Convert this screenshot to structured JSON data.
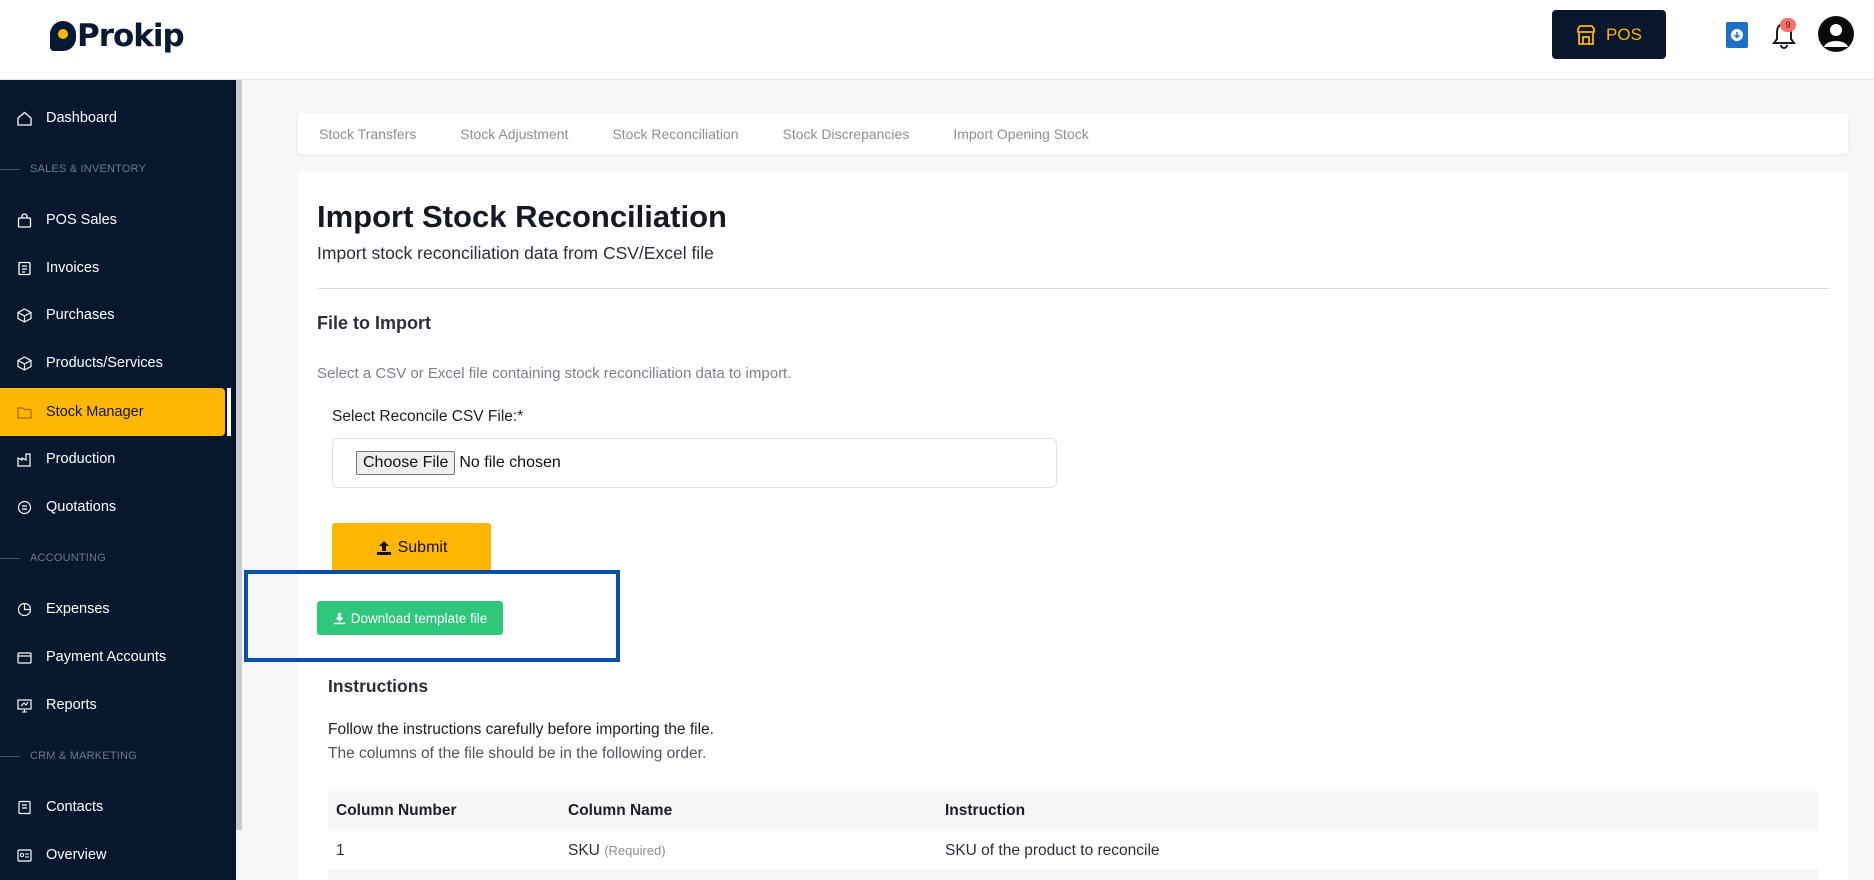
{
  "header": {
    "logo_text": "Prokip",
    "pos_label": "POS",
    "notification_count": "9"
  },
  "sidebar": {
    "items": [
      {
        "label": "Dashboard",
        "icon": "home-icon"
      },
      {
        "section": "SALES & INVENTORY"
      },
      {
        "label": "POS Sales",
        "icon": "bag-icon"
      },
      {
        "label": "Invoices",
        "icon": "invoice-icon"
      },
      {
        "label": "Purchases",
        "icon": "box-icon"
      },
      {
        "label": "Products/Services",
        "icon": "cube-icon"
      },
      {
        "label": "Stock Manager",
        "icon": "folder-icon",
        "active": true
      },
      {
        "label": "Production",
        "icon": "factory-icon"
      },
      {
        "label": "Quotations",
        "icon": "quote-icon"
      },
      {
        "section": "ACCOUNTING"
      },
      {
        "label": "Expenses",
        "icon": "pie-icon"
      },
      {
        "label": "Payment Accounts",
        "icon": "wallet-icon"
      },
      {
        "label": "Reports",
        "icon": "presentation-icon"
      },
      {
        "section": "CRM & MARKETING"
      },
      {
        "label": "Contacts",
        "icon": "contacts-icon"
      },
      {
        "label": "Overview",
        "icon": "overview-icon"
      }
    ]
  },
  "tabs": [
    "Stock Transfers",
    "Stock Adjustment",
    "Stock Reconciliation",
    "Stock Discrepancies",
    "Import Opening Stock"
  ],
  "page": {
    "title": "Import Stock Reconciliation",
    "subtitle": "Import stock reconciliation data from CSV/Excel file",
    "section_title": "File to Import",
    "help_text": "Select a CSV or Excel file containing stock reconciliation data to import.",
    "field_label": "Select Reconcile CSV File:*",
    "choose_file_label": "Choose File",
    "no_file_text": "No file chosen",
    "submit_label": "Submit",
    "download_label": "Download template file"
  },
  "instructions": {
    "title": "Instructions",
    "line1": "Follow the instructions carefully before importing the file.",
    "line2": "The columns of the file should be in the following order.",
    "columns": [
      "Column Number",
      "Column Name",
      "Instruction"
    ],
    "rows": [
      {
        "number": "1",
        "name": "SKU",
        "required": "(Required)",
        "instruction": "SKU of the product to reconcile"
      }
    ]
  },
  "colors": {
    "sidebar_bg": "#06172e",
    "accent": "#ffb703",
    "download_green": "#2ec77c",
    "highlight_border": "#0b4fa8"
  }
}
